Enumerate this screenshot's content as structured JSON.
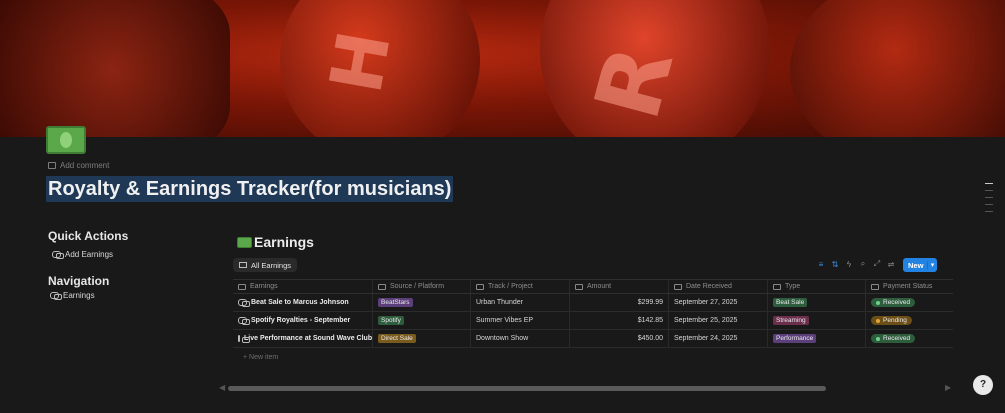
{
  "page": {
    "add_comment": "Add comment",
    "title": "Royalty & Earnings Tracker(for musicians)"
  },
  "sidebar": {
    "quick_actions_title": "Quick Actions",
    "quick_actions": [
      {
        "label": "Add Earnings"
      }
    ],
    "navigation_title": "Navigation",
    "navigation": [
      {
        "label": "Earnings"
      }
    ]
  },
  "database": {
    "title": "Earnings",
    "view_tab": "All Earnings",
    "new_button": "New",
    "columns": [
      "Earnings",
      "Source / Platform",
      "Track / Project",
      "Amount",
      "Date Received",
      "Type",
      "Payment Status"
    ],
    "rows": [
      {
        "name": "Beat Sale to Marcus Johnson",
        "source": "BeatStars",
        "track": "Urban Thunder",
        "amount": "$299.99",
        "date": "September 27, 2025",
        "type": "Beat Sale",
        "status": "Received"
      },
      {
        "name": "Spotify Royalties - September",
        "source": "Spotify",
        "track": "Summer Vibes EP",
        "amount": "$142.85",
        "date": "September 25, 2025",
        "type": "Streaming",
        "status": "Pending"
      },
      {
        "name": "Live Performance at Sound Wave Club",
        "source": "Direct Sale",
        "track": "Downtown Show",
        "amount": "$450.00",
        "date": "September 24, 2025",
        "type": "Performance",
        "status": "Received"
      }
    ],
    "new_item": "New item"
  },
  "colors": {
    "accent": "#2383e2",
    "tag_beatstars": "#5b3f7a",
    "tag_spotify": "#2e5d3e",
    "tag_direct": "#7a5b1e",
    "type_beat_sale": "#2e5d3e",
    "type_streaming": "#6b2f4d",
    "type_performance": "#5b3f7a",
    "status_received": "#2e5d3e",
    "status_pending": "#6b4f16"
  },
  "icons": [
    "money-icon",
    "comment-icon",
    "link-icon",
    "table-icon",
    "filter-icon",
    "sort-icon",
    "lightning-icon",
    "search-icon",
    "expand-icon",
    "settings-icon",
    "help-icon"
  ]
}
